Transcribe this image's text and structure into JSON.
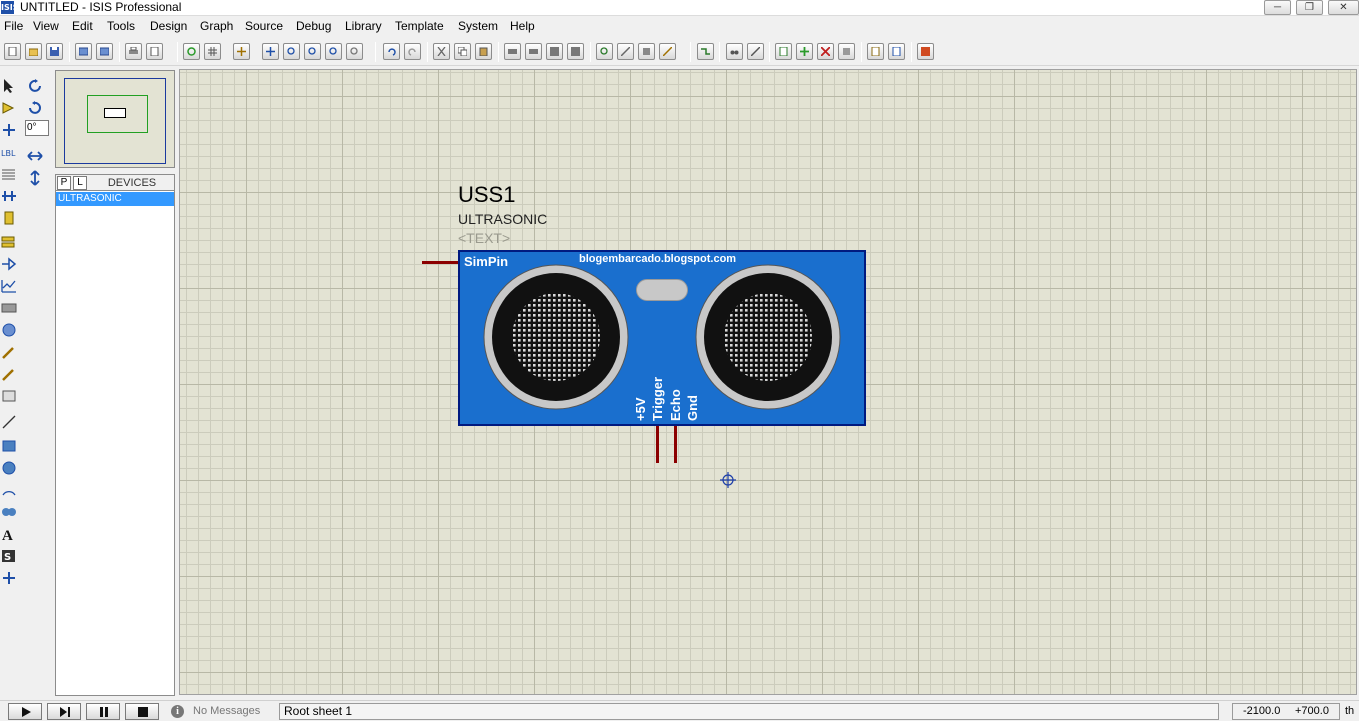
{
  "window": {
    "icon_text": "ISIS",
    "title": "UNTITLED - ISIS Professional"
  },
  "menu": [
    "File",
    "View",
    "Edit",
    "Tools",
    "Design",
    "Graph",
    "Source",
    "Debug",
    "Library",
    "Template",
    "System",
    "Help"
  ],
  "left_panel": {
    "rotation_value": "0°",
    "tabs": [
      "P",
      "L"
    ],
    "devices_header": "DEVICES",
    "devices": [
      "ULTRASONIC"
    ]
  },
  "component": {
    "reference": "USS1",
    "value": "ULTRASONIC",
    "text_placeholder": "<TEXT>",
    "sim_pin_label": "SimPin",
    "blog_label": "blogembarcado.blogspot.com",
    "pins": [
      "+5V",
      "Trigger",
      "Echo",
      "Gnd"
    ],
    "body_color": "#1a6fce",
    "wire_color": "#8b0000"
  },
  "status": {
    "messages": "No Messages",
    "sheet": "Root sheet 1",
    "coord_x": "-2100.0",
    "coord_y": "+700.0",
    "unit": "th"
  },
  "colors": {
    "canvas": "#e3e3d3",
    "selection": "#3399ff"
  }
}
